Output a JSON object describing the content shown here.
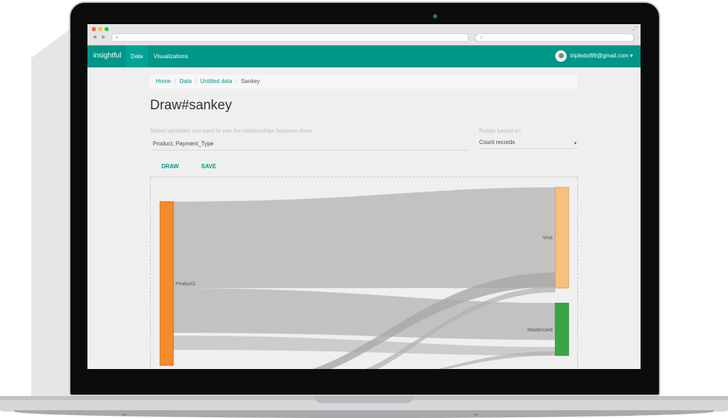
{
  "browser": {
    "traffic_lights": [
      "#ff5f57",
      "#ffbd2e",
      "#28c940"
    ],
    "back_forward": "◀ ▶",
    "new_tab": "+",
    "search_symbol": "⌕",
    "expand_symbol": "⤢"
  },
  "navbar": {
    "brand": "insightful",
    "items": [
      {
        "label": "Data",
        "active": true
      },
      {
        "label": "Visualizations",
        "active": false
      }
    ],
    "user_email": "tripledot99@gmail.com",
    "color": "#009688"
  },
  "breadcrumb": {
    "items": [
      "Home",
      "Data",
      "Untitled data",
      "Sankey"
    ],
    "separator": "/"
  },
  "page": {
    "title": "Draw#sankey",
    "variables_label": "Select variables you want to see the relationships between them",
    "variables_value": "Product,  Payment_Type",
    "relate_label": "Relate based on",
    "relate_value": "Count records",
    "draw_button": "DRAW",
    "save_button": "SAVE"
  },
  "chart_data": {
    "type": "sankey",
    "nodes": [
      {
        "name": "Product1",
        "color": "#f58b2a"
      },
      {
        "name": "Visa",
        "color": "#f9bf7f"
      },
      {
        "name": "Mastercard",
        "color": "#3aa547"
      }
    ],
    "links": [
      {
        "source": "Product1",
        "target": "Visa"
      },
      {
        "source": "Product1",
        "target": "Mastercard"
      }
    ],
    "link_color": "#bdbdbd"
  }
}
